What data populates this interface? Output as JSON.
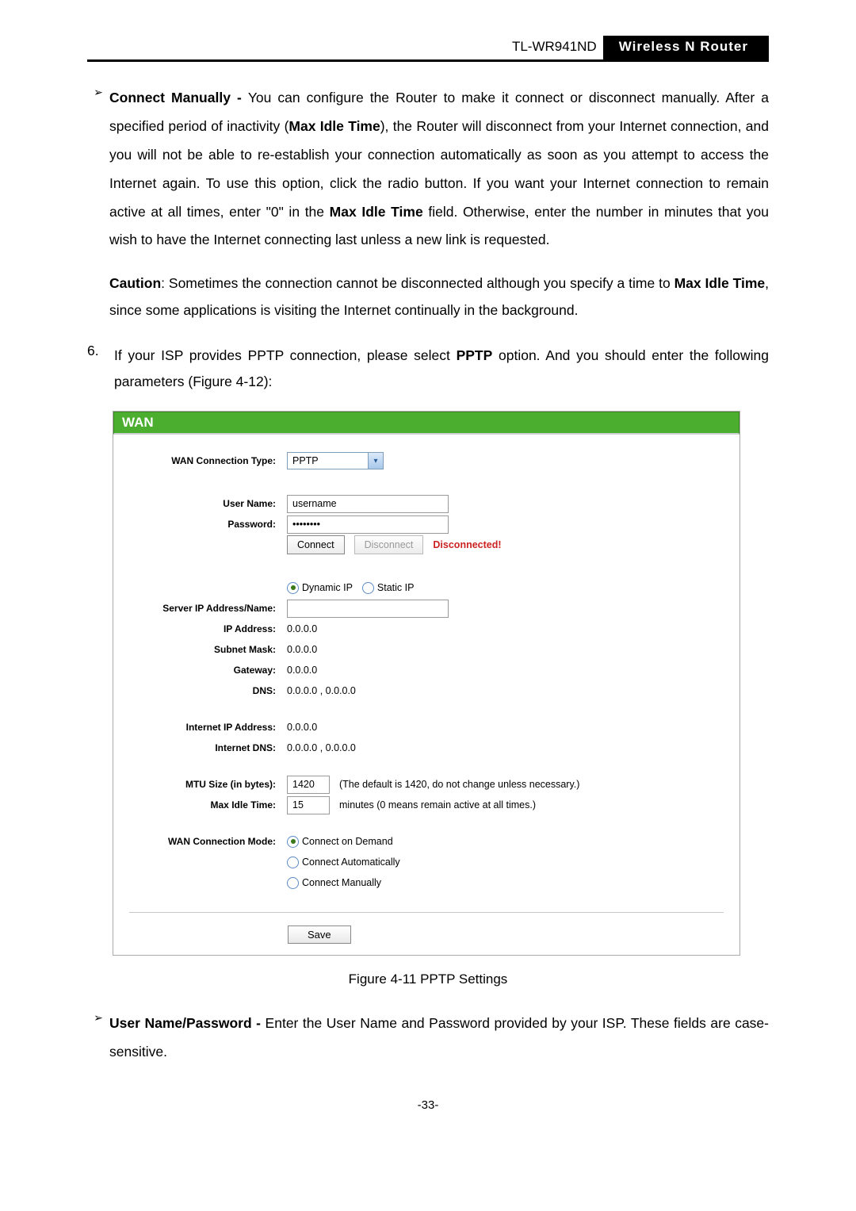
{
  "header": {
    "model": "TL-WR941ND",
    "product": "Wireless  N  Router"
  },
  "bullet1": {
    "lead": "Connect Manually - ",
    "part1": "You can configure the Router to make it connect or disconnect manually. After a specified period of inactivity (",
    "mit": "Max Idle Time",
    "part2": "), the Router will disconnect from your Internet connection, and you will not be able to re-establish your connection automatically as soon as you attempt to access the Internet again. To use this option, click the radio button. If you want your Internet connection to remain active at all times, enter \"0\" in the ",
    "mit2": "Max Idle Time",
    "part3": " field. Otherwise, enter the number in minutes that you wish to have the Internet connecting last unless a new link is requested."
  },
  "caution": {
    "lead": "Caution",
    "part1": ": Sometimes the connection cannot be disconnected although you specify a time to ",
    "mit": "Max Idle Time",
    "part2": ", since some applications is visiting the Internet continually in the background."
  },
  "step6": {
    "num": "6.",
    "part1": "If your ISP provides PPTP connection, please select ",
    "pptp": "PPTP",
    "part2": " option. And you should enter the following parameters (Figure 4-12):"
  },
  "form": {
    "title": "WAN",
    "labels": {
      "conn_type": "WAN Connection Type:",
      "username": "User Name:",
      "password": "Password:",
      "server": "Server IP Address/Name:",
      "ip": "IP Address:",
      "subnet": "Subnet Mask:",
      "gateway": "Gateway:",
      "dns": "DNS:",
      "inet_ip": "Internet IP Address:",
      "inet_dns": "Internet DNS:",
      "mtu": "MTU Size (in bytes):",
      "idle": "Max Idle Time:",
      "mode": "WAN Connection Mode:"
    },
    "values": {
      "conn_type": "PPTP",
      "username": "username",
      "password": "••••••••",
      "connect_btn": "Connect",
      "disconnect_btn": "Disconnect",
      "status": "Disconnected!",
      "radio_dynamic": "Dynamic IP",
      "radio_static": "Static IP",
      "ip": "0.0.0.0",
      "subnet": "0.0.0.0",
      "gateway": "0.0.0.0",
      "dns": "0.0.0.0 , 0.0.0.0",
      "inet_ip": "0.0.0.0",
      "inet_dns": "0.0.0.0 , 0.0.0.0",
      "mtu": "1420",
      "mtu_hint": "(The default is 1420, do not change unless necessary.)",
      "idle": "15",
      "idle_hint": "minutes (0 means remain active at all times.)",
      "mode_demand": "Connect on Demand",
      "mode_auto": "Connect Automatically",
      "mode_manual": "Connect Manually",
      "save": "Save"
    }
  },
  "caption": "Figure 4-11    PPTP Settings",
  "bullet2": {
    "lead": "User Name/Password - ",
    "text": "Enter the User Name and Password provided by your ISP. These fields are case-sensitive."
  },
  "pagenum": "-33-"
}
